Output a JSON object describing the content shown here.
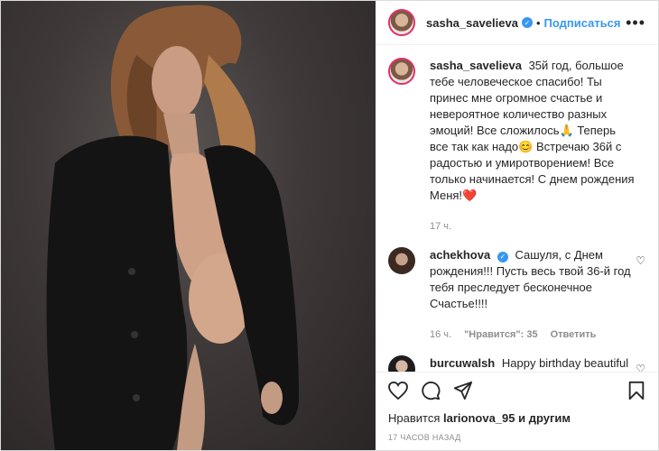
{
  "header": {
    "username": "sasha_savelieva",
    "separator": "•",
    "follow_label": "Подписаться",
    "more": "•••"
  },
  "caption": {
    "username": "sasha_savelieva",
    "text": "35й год, большое тебе человеческое спасибо! Ты принес мне огромное счастье и невероятное количество разных эмоций! Все сложилось🙏 Теперь все так как надо😊 Встречаю 36й с радостью и умиротворением! Все только начинается! С днем рождения Меня!❤️",
    "time": "17 ч."
  },
  "comments": [
    {
      "username": "achekhova",
      "text": "Сашуля, с Днем рождения!!! Пусть весь твой 36-й год тебя преследует бесконечное Счастье!!!!",
      "time": "16 ч.",
      "likes": "\"Нравится\": 35",
      "reply": "Ответить"
    },
    {
      "username": "burcuwalsh",
      "text": "Happy birthday beautiful❤️❤️❤️"
    }
  ],
  "likes": {
    "prefix": "Нравится",
    "user": "larionova_95",
    "suffix": "и другим"
  },
  "timestamp": "17 ЧАСОВ НАЗАД",
  "icons": [
    "heart-icon",
    "comment-icon",
    "share-icon",
    "bookmark-icon"
  ],
  "colors": {
    "accent": "#3897f0",
    "verified": "#3897f0",
    "text": "#262626",
    "muted": "#8e8e8e"
  }
}
